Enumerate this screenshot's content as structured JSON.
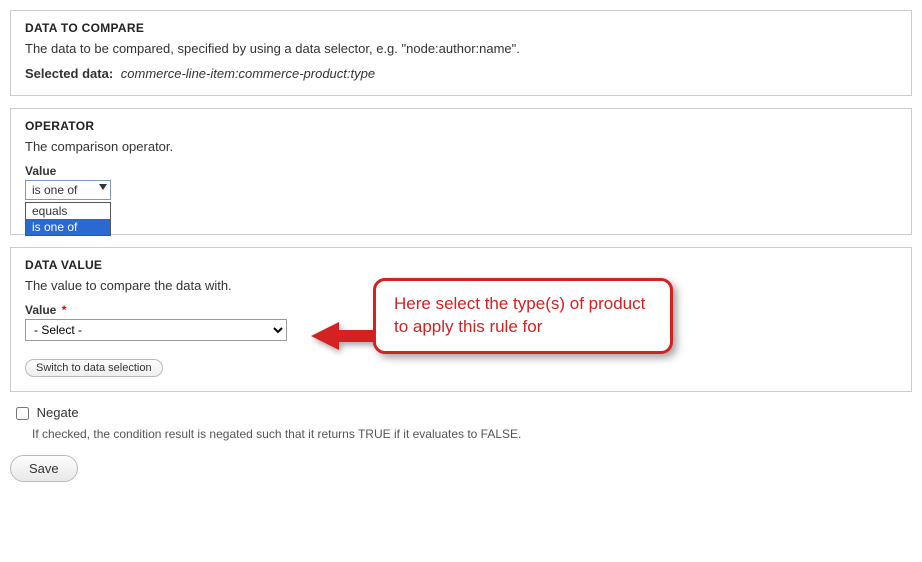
{
  "data_to_compare": {
    "title": "DATA TO COMPARE",
    "description": "The data to be compared, specified by using a data selector, e.g. \"node:author:name\".",
    "selected_label": "Selected data:",
    "selected_value": "commerce-line-item:commerce-product:type"
  },
  "operator": {
    "title": "OPERATOR",
    "description": "The comparison operator.",
    "field_label": "Value",
    "selected": "is one of",
    "options": [
      "equals",
      "is one of"
    ]
  },
  "data_value": {
    "title": "DATA VALUE",
    "description": "The value to compare the data with.",
    "field_label": "Value",
    "required": true,
    "select_placeholder": "- Select -",
    "switch_button": "Switch to data selection"
  },
  "negate": {
    "label": "Negate",
    "description": "If checked, the condition result is negated such that it returns TRUE if it evaluates to FALSE.",
    "checked": false
  },
  "save_label": "Save",
  "annotation": {
    "text": "Here select the type(s) of product to apply this rule for"
  }
}
